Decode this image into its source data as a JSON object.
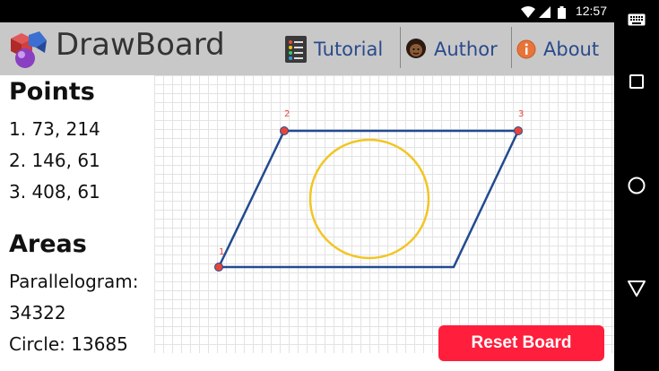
{
  "status": {
    "time": "12:57"
  },
  "header": {
    "title": "DrawBoard",
    "menu": [
      {
        "label": "Tutorial",
        "icon": "list-icon"
      },
      {
        "label": "Author",
        "icon": "person-icon"
      },
      {
        "label": "About",
        "icon": "info-icon"
      }
    ]
  },
  "sidebar": {
    "points_heading": "Points",
    "points": [
      "1. 73, 214",
      "2. 146, 61",
      "3. 408, 61"
    ],
    "areas_heading": "Areas",
    "parallelogram_label": "Parallelogram:",
    "parallelogram_value": "34322",
    "circle_label": "Circle: 13685"
  },
  "board": {
    "point_labels": [
      "1",
      "2",
      "3"
    ],
    "colors": {
      "parallelogram": "#224b8f",
      "circle": "#f2c522",
      "point": "#e8443a",
      "label": "#e8443a"
    }
  },
  "reset_label": "Reset Board"
}
